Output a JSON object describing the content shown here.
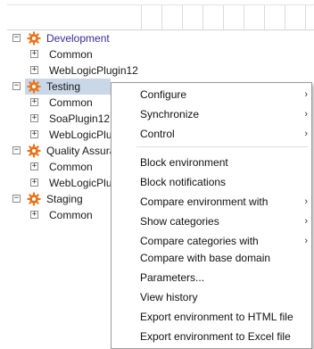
{
  "tree": {
    "environments": [
      {
        "label": "Development",
        "toggle": "−",
        "children": [
          "Common",
          "WebLogicPlugin12"
        ]
      },
      {
        "label": "Testing",
        "toggle": "−",
        "selected": true,
        "children": [
          "Common",
          "SoaPlugin12",
          "WebLogicPlu"
        ]
      },
      {
        "label": "Quality Assura",
        "toggle": "−",
        "children": [
          "Common",
          "WebLogicPlu"
        ]
      },
      {
        "label": "Staging",
        "toggle": "−",
        "children": [
          "Common"
        ]
      }
    ],
    "child_toggle": "+",
    "env_icon": "gear-icon"
  },
  "menu": {
    "items": [
      {
        "label": "Configure",
        "submenu": true
      },
      {
        "label": "Synchronize",
        "submenu": true
      },
      {
        "label": "Control",
        "submenu": true
      },
      {
        "label": "Block environment",
        "submenu": false
      },
      {
        "label": "Block notifications",
        "submenu": false
      },
      {
        "label": "Compare environment with",
        "submenu": true
      },
      {
        "label": "Show categories",
        "submenu": true
      },
      {
        "label": "Compare categories with",
        "submenu": true
      },
      {
        "label": "Compare with base domain",
        "submenu": false
      },
      {
        "label": "Parameters...",
        "submenu": false
      },
      {
        "label": "View history",
        "submenu": false
      },
      {
        "label": "Export environment to HTML file",
        "submenu": false
      },
      {
        "label": "Export environment to Excel file",
        "submenu": false
      }
    ],
    "submenu_arrow": "›"
  },
  "colors": {
    "selection": "#c9d7e6",
    "gear": "#e8741c",
    "dev_label": "#3a2a9a"
  }
}
